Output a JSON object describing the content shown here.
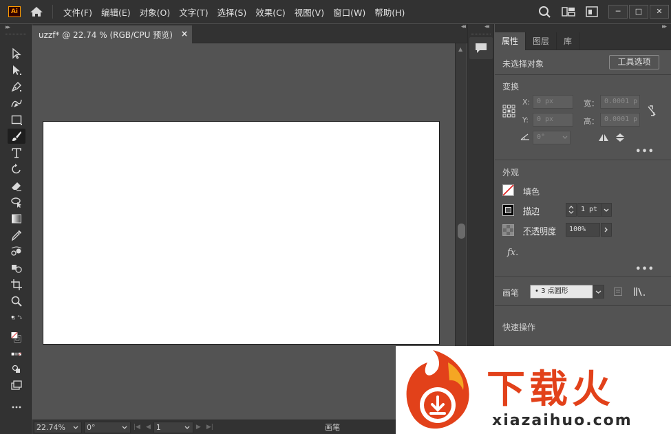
{
  "app": {
    "logo_text": "Ai"
  },
  "menu": [
    "文件(F)",
    "编辑(E)",
    "对象(O)",
    "文字(T)",
    "选择(S)",
    "效果(C)",
    "视图(V)",
    "窗口(W)",
    "帮助(H)"
  ],
  "document": {
    "tab_title": "uzzf* @ 22.74 % (RGB/CPU 预览)",
    "close_label": "×"
  },
  "statusbar": {
    "zoom": "22.74%",
    "rotation": "0°",
    "artboard": "1",
    "tool_name": "画笔"
  },
  "panel": {
    "tabs": [
      "属性",
      "图层",
      "库"
    ],
    "no_selection": "未选择对象",
    "tool_options_button": "工具选项",
    "transform": {
      "title": "变换",
      "x_label": "X:",
      "x_value": "0 px",
      "y_label": "Y:",
      "y_value": "0 px",
      "w_label": "宽：",
      "w_value": "0.0001 p",
      "h_label": "高：",
      "h_value": "0.0001 p",
      "angle_value": "0°"
    },
    "appearance": {
      "title": "外观",
      "fill_label": "填色",
      "stroke_label": "描边",
      "stroke_value": "1 pt",
      "opacity_label": "不透明度",
      "opacity_value": "100%",
      "fx_label": "fx."
    },
    "brush": {
      "label": "画笔",
      "value": "•  3 点圆形"
    },
    "quick_actions": {
      "title": "快速操作"
    }
  },
  "watermark": {
    "brand_text": "下载火",
    "url": "xiazaihuo.com",
    "brand_color": "#e2411a"
  },
  "colors": {
    "ui_dark": "#323232",
    "ui_mid": "#535353",
    "artboard": "#ffffff",
    "ai_accent": "#ff9a00"
  }
}
